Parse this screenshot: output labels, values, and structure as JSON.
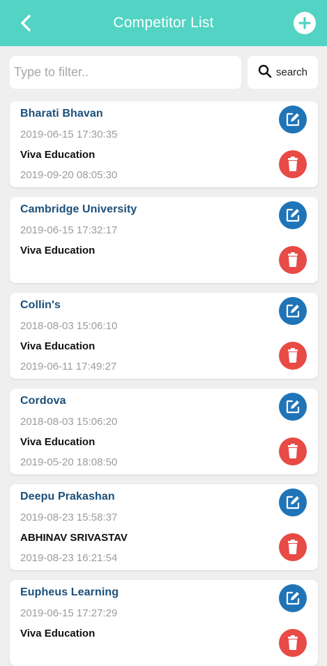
{
  "header": {
    "title": "Competitor List",
    "back_icon": "back-chevron-icon",
    "add_icon": "plus-circle-icon",
    "color": "#52d3c3"
  },
  "filter": {
    "placeholder": "Type to filter..",
    "value": "",
    "search_label": "search",
    "search_icon": "search-icon"
  },
  "colors": {
    "name": "#1b4f7a",
    "edit": "#1f74b8",
    "delete": "#e84a45"
  },
  "items": [
    {
      "name": "Bharati Bhavan",
      "created": "2019-06-15 17:30:35",
      "modified_by": "Viva Education",
      "modified": "2019-09-20 08:05:30"
    },
    {
      "name": "Cambridge University",
      "created": "2019-06-15 17:32:17",
      "modified_by": "Viva Education",
      "modified": ""
    },
    {
      "name": "Collin's",
      "created": "2018-08-03 15:06:10",
      "modified_by": "Viva Education",
      "modified": "2019-06-11 17:49:27"
    },
    {
      "name": "Cordova",
      "created": "2018-08-03 15:06:20",
      "modified_by": "Viva Education",
      "modified": "2019-05-20 18:08:50"
    },
    {
      "name": "Deepu Prakashan",
      "created": "2019-08-23 15:58:37",
      "modified_by": "ABHINAV SRIVASTAV",
      "modified": "2019-08-23 16:21:54"
    },
    {
      "name": "Eupheus Learning",
      "created": "2019-06-15 17:27:29",
      "modified_by": "Viva Education",
      "modified": ""
    }
  ]
}
